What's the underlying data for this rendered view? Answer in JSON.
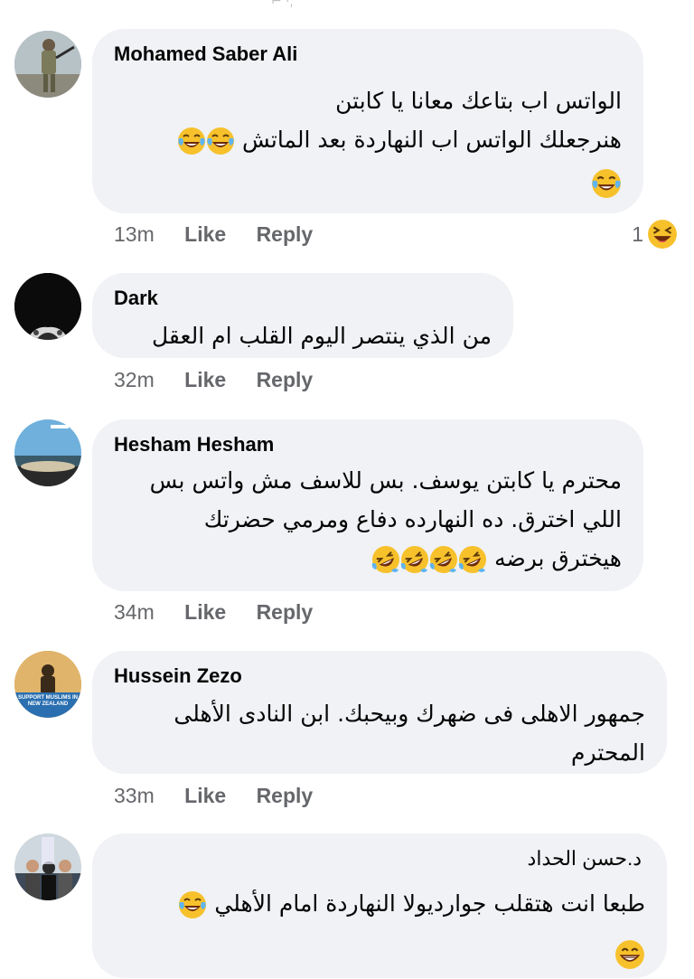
{
  "comments": [
    {
      "author": "Mohamed Saber Ali",
      "lines": [
        "الواتس اب بتاعك معانا يا كابتن",
        "هنرجعلك الواتس اب النهاردة بعد الماتش"
      ],
      "time": "13m",
      "like": "Like",
      "reply": "Reply",
      "reaction_count": "1"
    },
    {
      "author": "Dark",
      "lines": [
        "من الذي ينتصر اليوم القلب ام العقل"
      ],
      "time": "32m",
      "like": "Like",
      "reply": "Reply"
    },
    {
      "author": "Hesham Hesham",
      "lines": [
        "محترم يا كابتن يوسف. بس للاسف مش واتس بس",
        "اللي اخترق. ده النهارده دفاع ومرمي حضرتك",
        "هيخترق برضه"
      ],
      "time": "34m",
      "like": "Like",
      "reply": "Reply"
    },
    {
      "author": "Hussein Zezo",
      "lines": [
        "جمهور الاهلى فى ضهرك وبيحبك. ابن النادى الأهلى",
        "المحترم"
      ],
      "time": "33m",
      "like": "Like",
      "reply": "Reply"
    },
    {
      "author": "د.حسن الحداد",
      "lines": [
        "طبعا انت هتقلب جوارديولا النهاردة امام الأهلي"
      ]
    }
  ],
  "avatar_banner": "SUPPORT MUSLIMS IN NEW ZEALAND",
  "colors": {
    "bubble": "#f0f2f5",
    "meta": "#65676b",
    "emoji": "#f7c12c"
  }
}
